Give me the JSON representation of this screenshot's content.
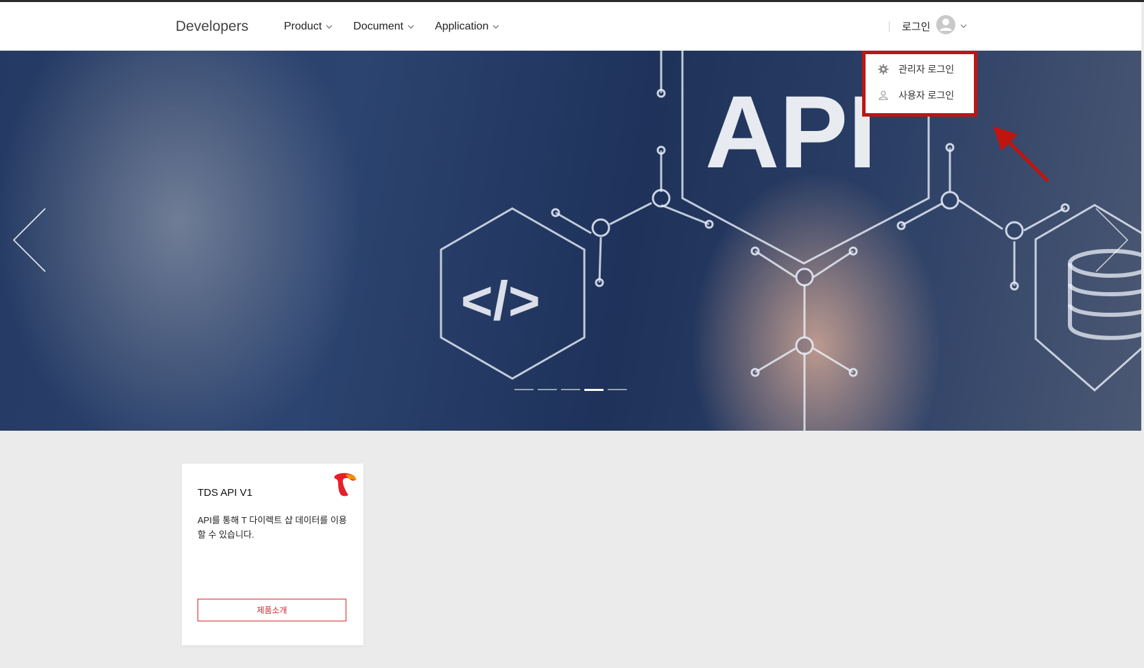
{
  "header": {
    "brand": "Developers",
    "nav": [
      {
        "label": "Product"
      },
      {
        "label": "Document"
      },
      {
        "label": "Application"
      }
    ],
    "login_label": "로그인"
  },
  "dropdown": {
    "items": [
      {
        "label": "관리자 로그인",
        "icon": "gear-icon"
      },
      {
        "label": "사용자 로그인",
        "icon": "user-icon"
      }
    ]
  },
  "hero": {
    "title_text": "API",
    "code_text": "</>",
    "slides_total": 5,
    "active_slide": 4
  },
  "card": {
    "title": "TDS API V1",
    "description": "API를 통해 T 다이렉트 샵 데이터를 이용할 수 있습니다.",
    "button_label": "제품소개"
  },
  "colors": {
    "annotation_red": "#c0150f",
    "button_red": "#d9232c"
  }
}
